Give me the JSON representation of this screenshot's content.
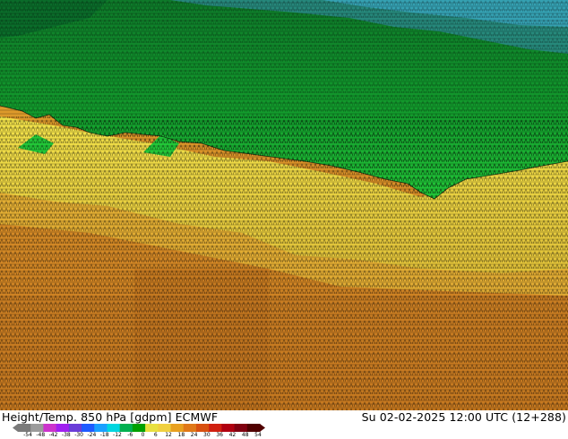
{
  "map": {
    "title": "Height/Temp. 850 hPa [gdpm] ECMWF",
    "valid_time": "Su 02-02-2025 12:00 UTC (12+288)"
  },
  "colorbar": {
    "ticks": [
      "-54",
      "-48",
      "-42",
      "-38",
      "-30",
      "-24",
      "-18",
      "-12",
      "-6",
      "0",
      "6",
      "12",
      "18",
      "24",
      "30",
      "36",
      "42",
      "48",
      "54"
    ],
    "colors": [
      "#7a7a7a",
      "#9b9b9b",
      "#cc33cc",
      "#a020f0",
      "#6a3dd8",
      "#1f5bff",
      "#1aa0ff",
      "#00d6e0",
      "#00b050",
      "#00a000",
      "#e8e040",
      "#f0d040",
      "#e8a020",
      "#e07818",
      "#d85010",
      "#d02010",
      "#b00010",
      "#800010",
      "#500000"
    ]
  }
}
